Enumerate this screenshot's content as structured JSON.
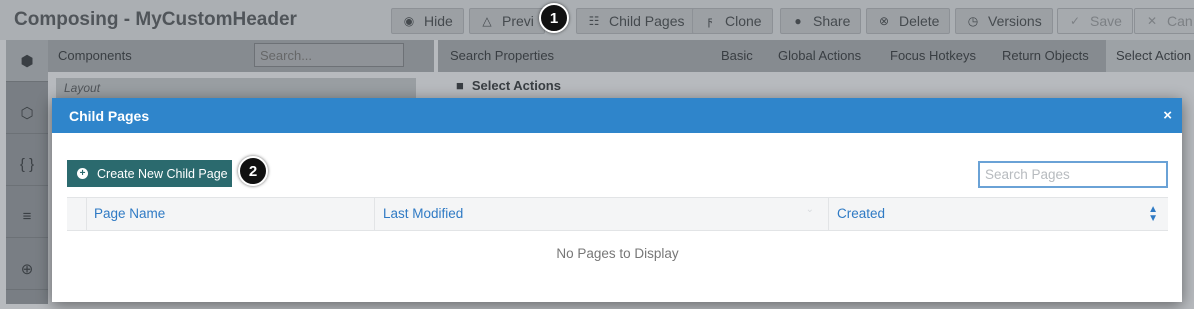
{
  "app": {
    "title": "Composing - MyCustomHeader",
    "toolbar": [
      {
        "label": "Hide",
        "icon": "eye-icon"
      },
      {
        "label": "Previ",
        "icon": "flask-icon"
      },
      {
        "label": "Child Pages",
        "icon": "sitemap-icon"
      },
      {
        "label": "Clone",
        "icon": "fork-icon"
      },
      {
        "label": "Share",
        "icon": "globe-icon"
      },
      {
        "label": "Delete",
        "icon": "close-circle-icon"
      },
      {
        "label": "Versions",
        "icon": "clock-icon"
      },
      {
        "label": "Save",
        "icon": "check-icon"
      },
      {
        "label": "Can",
        "icon": "close-icon"
      }
    ],
    "left_rail_icons": [
      "cube-icon",
      "cubes-icon",
      "braces-icon",
      "css3-icon",
      "globe-icon"
    ],
    "components": {
      "title": "Components",
      "search_placeholder": "Search...",
      "layout_label": "Layout"
    },
    "properties": {
      "search_label": "Search Properties",
      "tabs": [
        "Basic",
        "Global Actions",
        "Focus Hotkeys",
        "Return Objects",
        "Select Action"
      ],
      "active_tab": "Select Action",
      "section": "Select Actions"
    }
  },
  "callouts": [
    "1",
    "2"
  ],
  "modal": {
    "title": "Child Pages",
    "close_symbol": "×",
    "create_button": "Create New Child Page",
    "create_icon": "+",
    "search_placeholder": "Search Pages",
    "columns": [
      "Page Name",
      "Last Modified",
      "Created"
    ],
    "empty_message": "No Pages to Display"
  },
  "colors": {
    "header_blue": "#2f85cb",
    "create_button": "#2b6a6e",
    "link_blue": "#2f7ac4"
  }
}
